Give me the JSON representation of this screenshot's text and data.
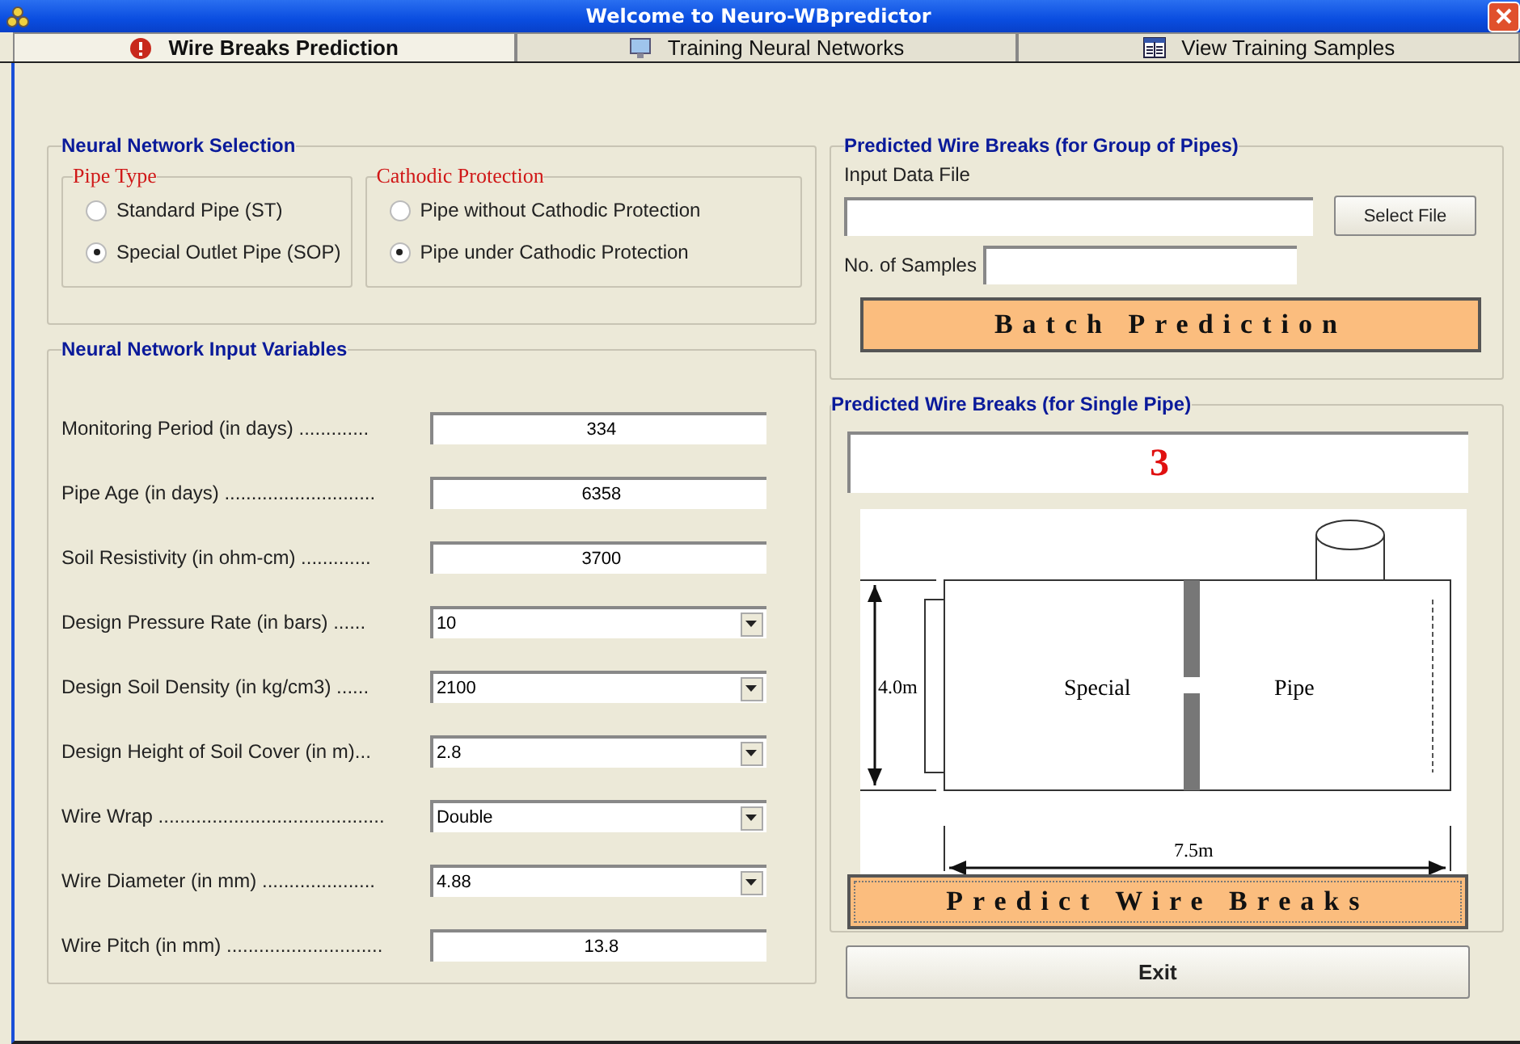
{
  "window": {
    "title": "Welcome to Neuro-WBpredictor"
  },
  "tabs": [
    {
      "label": "Wire Breaks Prediction",
      "selected": true
    },
    {
      "label": "Training Neural Networks",
      "selected": false
    },
    {
      "label": "View Training Samples",
      "selected": false
    }
  ],
  "network_selection": {
    "title": "Neural Network Selection",
    "groups": [
      {
        "title": "Pipe Type",
        "options": [
          {
            "label": "Standard Pipe (ST)",
            "selected": false
          },
          {
            "label": "Special Outlet Pipe (SOP)",
            "selected": true
          }
        ]
      },
      {
        "title": "Cathodic Protection",
        "options": [
          {
            "label": "Pipe without Cathodic Protection",
            "selected": false
          },
          {
            "label": "Pipe under Cathodic Protection",
            "selected": true
          }
        ]
      }
    ]
  },
  "input_variables": {
    "title": "Neural Network Input Variables",
    "rows": [
      {
        "label": "Monitoring Period (in days) .............",
        "kind": "text",
        "value": "334"
      },
      {
        "label": "Pipe Age (in days) ............................",
        "kind": "text",
        "value": "6358"
      },
      {
        "label": "Soil Resistivity (in ohm-cm) .............",
        "kind": "text",
        "value": "3700"
      },
      {
        "label": "Design Pressure Rate (in bars) ......",
        "kind": "dropdown",
        "value": "10"
      },
      {
        "label": "Design Soil Density (in kg/cm3) ......",
        "kind": "dropdown",
        "value": "2100"
      },
      {
        "label": "Design Height of Soil Cover (in m)...",
        "kind": "dropdown",
        "value": "2.8"
      },
      {
        "label": "Wire Wrap ..........................................",
        "kind": "dropdown",
        "value": "Double"
      },
      {
        "label": "Wire Diameter (in mm) .....................",
        "kind": "dropdown",
        "value": "4.88"
      },
      {
        "label": "Wire Pitch (in mm) .............................",
        "kind": "text",
        "value": "13.8"
      }
    ]
  },
  "group_prediction": {
    "title": "Predicted Wire Breaks (for Group of Pipes)",
    "file_label": "Input Data File",
    "select_button": "Select File",
    "samples_label": "No. of Samples",
    "batch_button": "Batch Prediction"
  },
  "single_prediction": {
    "title": "Predicted Wire Breaks (for Single Pipe)",
    "result": "3",
    "diagram": {
      "height_label": "4.0m",
      "left_label": "Special",
      "right_label": "Pipe",
      "length_label": "7.5m"
    },
    "predict_button": "Predict Wire Breaks"
  },
  "exit_button": "Exit"
}
